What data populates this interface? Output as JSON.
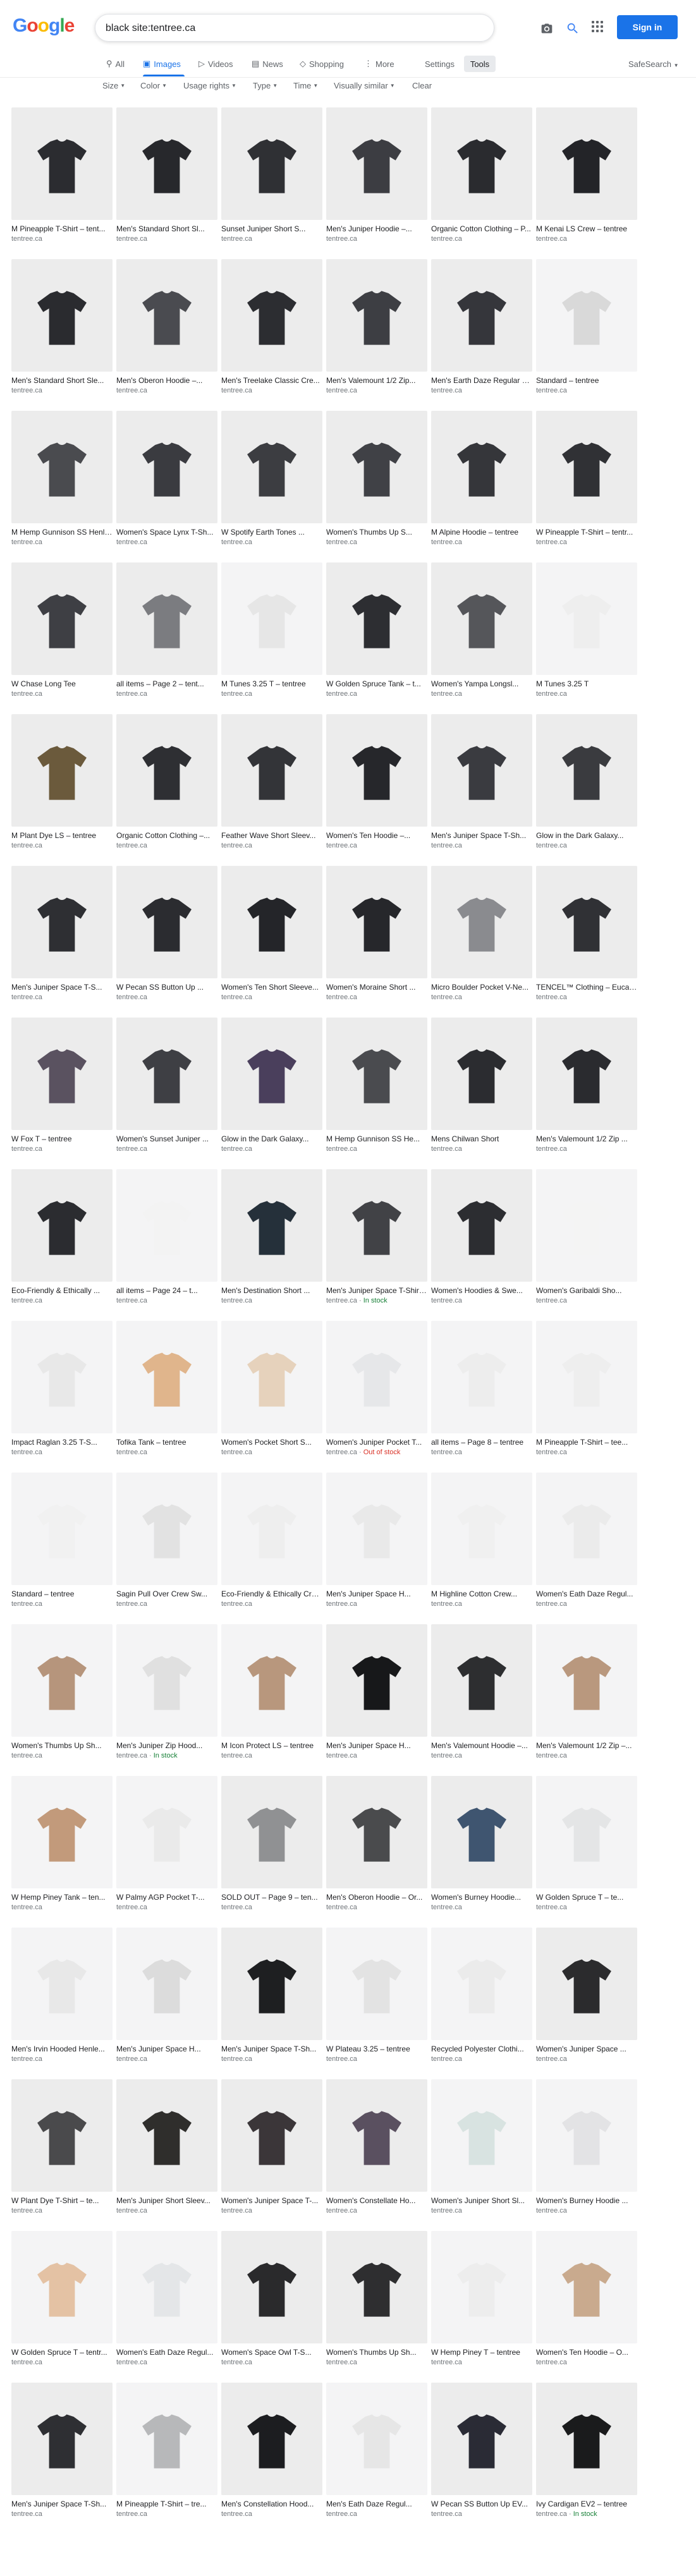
{
  "header": {
    "logo": "Google",
    "query": "black site:tentree.ca",
    "signin_label": "Sign in",
    "logo_colors": [
      "#4285f4",
      "#ea4335",
      "#fbbc05",
      "#4285f4",
      "#34a853",
      "#ea4335"
    ]
  },
  "tabs": [
    {
      "label": "All",
      "icon": "search-icon"
    },
    {
      "label": "Images",
      "icon": "image-icon"
    },
    {
      "label": "Videos",
      "icon": "video-icon"
    },
    {
      "label": "News",
      "icon": "news-icon"
    },
    {
      "label": "Shopping",
      "icon": "tag-icon"
    },
    {
      "label": "More",
      "icon": "more-icon"
    }
  ],
  "toolbar": {
    "settings": "Settings",
    "tools": "Tools",
    "safesearch": "SafeSearch"
  },
  "filters": [
    "Size",
    "Color",
    "Usage rights",
    "Type",
    "Time",
    "Visually similar",
    "Clear"
  ],
  "source_default": "tentree.ca",
  "rows": [
    [
      {
        "title": "M Pineapple T-Shirt – tent...",
        "color": "#2b2c30"
      },
      {
        "title": "Men's Standard Short Sl...",
        "color": "#27282c"
      },
      {
        "title": "Sunset Juniper Short S...",
        "color": "#2f3034"
      },
      {
        "title": "Men's Juniper Hoodie –...",
        "color": "#3c3d42"
      },
      {
        "title": "Organic Cotton Clothing – P...",
        "color": "#2a2b2f"
      },
      {
        "title": "M Kenai LS Crew – tentree",
        "color": "#232428"
      }
    ],
    [
      {
        "title": "Men's Standard Short Sle...",
        "color": "#2a2b2f"
      },
      {
        "title": "Men's Oberon Hoodie –...",
        "color": "#4a4b50"
      },
      {
        "title": "Men's Treelake Classic Cre...",
        "color": "#2c2d31"
      },
      {
        "title": "Men's Valemount 1/2 Zip...",
        "color": "#3d3e43"
      },
      {
        "title": "Men's Earth Daze Regular Fi...",
        "color": "#35363b"
      },
      {
        "title": "Standard – tentree",
        "color": "#d9d9d9"
      }
    ],
    [
      {
        "title": "M Hemp Gunnison SS Henley...",
        "color": "#4a4b4f"
      },
      {
        "title": "Women's Space Lynx T-Sh...",
        "color": "#3a3b40"
      },
      {
        "title": "W Spotify Earth Tones ...",
        "color": "#3c3d41"
      },
      {
        "title": "Women's Thumbs Up S...",
        "color": "#404146"
      },
      {
        "title": "M Alpine Hoodie – tentree",
        "color": "#35363a"
      },
      {
        "title": "W Pineapple T-Shirt – tentr...",
        "color": "#303135"
      }
    ],
    [
      {
        "title": "W Chase Long Tee",
        "color": "#3e3f44"
      },
      {
        "title": "all items – Page 2 – tent...",
        "color": "#7b7c80"
      },
      {
        "title": "M Tunes 3.25 T – tentree",
        "color": "#e6e6e6"
      },
      {
        "title": "W Golden Spruce Tank – t...",
        "color": "#2d2e32"
      },
      {
        "title": "Women's Yampa Longsl...",
        "color": "#55565a"
      },
      {
        "title": "M Tunes 3.25 T",
        "color": "#eeeeee"
      }
    ],
    [
      {
        "title": "M Plant Dye LS – tentree",
        "color": "#6b5a3c"
      },
      {
        "title": "Organic Cotton Clothing –...",
        "color": "#2e2f33"
      },
      {
        "title": "Feather Wave Short Sleev...",
        "color": "#333438"
      },
      {
        "title": "Women's Ten Hoodie –...",
        "color": "#26272b"
      },
      {
        "title": "Men's Juniper Space T-Sh...",
        "color": "#3a3b40"
      },
      {
        "title": "Glow in the Dark Galaxy...",
        "color": "#3a3b3f"
      }
    ],
    [
      {
        "title": "Men's Juniper Space T-S...",
        "color": "#2e2f33"
      },
      {
        "title": "W Pecan SS Button Up ...",
        "color": "#2b2c30"
      },
      {
        "title": "Women's Ten Short Sleeve...",
        "color": "#242529"
      },
      {
        "title": "Women's Moraine Short ...",
        "color": "#26272b"
      },
      {
        "title": "Micro Boulder Pocket V-Ne...",
        "color": "#8a8b8f"
      },
      {
        "title": "TENCEL™ Clothing – Eucal...",
        "color": "#303135"
      }
    ],
    [
      {
        "title": "W Fox T – tentree",
        "color": "#5a5260"
      },
      {
        "title": "Women's Sunset Juniper ...",
        "color": "#3e3f44"
      },
      {
        "title": "Glow in the Dark Galaxy...",
        "color": "#4a3f5c"
      },
      {
        "title": "M Hemp Gunnison SS He...",
        "color": "#4a4b4f"
      },
      {
        "title": "Mens Chilwan Short",
        "color": "#2b2c30"
      },
      {
        "title": "Men's Valemount 1/2 Zip ...",
        "color": "#2a2b2f"
      }
    ],
    [
      {
        "title": "Eco-Friendly & Ethically ...",
        "color": "#2b2c30"
      },
      {
        "title": "all items – Page 24 – t...",
        "color": "#f3f3f3"
      },
      {
        "title": "Men's Destination Short ...",
        "color": "#25303a"
      },
      {
        "title": "Men's Juniper Space T-Shirt – Tr...",
        "color": "#414246",
        "badge": "In stock"
      },
      {
        "title": "Women's Hoodies & Swe...",
        "color": "#2c2d31"
      },
      {
        "title": "Women's Garibaldi Sho...",
        "color": "#f4f4f4"
      }
    ],
    [
      {
        "title": "Impact Raglan 3.25 T-S...",
        "color": "#e8e8e8"
      },
      {
        "title": "Tofika Tank – tentree",
        "color": "#e0b58c"
      },
      {
        "title": "Women's Pocket Short S...",
        "color": "#e6d2bc"
      },
      {
        "title": "Women's Juniper Pocket T...",
        "color": "#e6e7e9",
        "badge": "Out of stock"
      },
      {
        "title": "all items – Page 8 – tentree",
        "color": "#ededed"
      },
      {
        "title": "M Pineapple T-Shirt – tee...",
        "color": "#eeeeee"
      }
    ],
    [
      {
        "title": "Standard – tentree",
        "color": "#f1f1f1"
      },
      {
        "title": "Sagin Pull Over Crew Sw...",
        "color": "#e2e2e2"
      },
      {
        "title": "Eco-Friendly & Ethically Craf...",
        "color": "#eeeeee"
      },
      {
        "title": "Men's Juniper Space H...",
        "color": "#e9e9e9"
      },
      {
        "title": "M Highline Cotton Crew...",
        "color": "#f0f0f0"
      },
      {
        "title": "Women's Eath Daze Regul...",
        "color": "#ebebeb"
      }
    ],
    [
      {
        "title": "Women's Thumbs Up Sh...",
        "color": "#b6957c"
      },
      {
        "title": "Men's Juniper Zip Hood...",
        "color": "#e0e0e0",
        "badge": "In stock"
      },
      {
        "title": "M Icon Protect LS – tentree",
        "color": "#b8977d"
      },
      {
        "title": "Men's Juniper Space H...",
        "color": "#17181a"
      },
      {
        "title": "Men's Valemount Hoodie –...",
        "color": "#2d2e30"
      },
      {
        "title": "Men's Valemount 1/2 Zip –...",
        "color": "#b9987e"
      }
    ],
    [
      {
        "title": "W Hemp Piney Tank – ten...",
        "color": "#c29a7b"
      },
      {
        "title": "W Palmy AGP Pocket T-...",
        "color": "#eaeaea"
      },
      {
        "title": "SOLD OUT – Page 9 – ten...",
        "color": "#909193"
      },
      {
        "title": "Men's Oberon Hoodie – Or...",
        "color": "#4a4b4d"
      },
      {
        "title": "Women's Burney Hoodie...",
        "color": "#3f5570"
      },
      {
        "title": "W Golden Spruce T – te...",
        "color": "#e4e5e6"
      }
    ],
    [
      {
        "title": "Men's Irvin Hooded Henle...",
        "color": "#e8e8e8"
      },
      {
        "title": "Men's Juniper Space H...",
        "color": "#dcdcdc"
      },
      {
        "title": "Men's Juniper Space T-Sh...",
        "color": "#1e1f21"
      },
      {
        "title": "W Plateau 3.25 – tentree",
        "color": "#e3e3e3"
      },
      {
        "title": "Recycled Polyester Clothi...",
        "color": "#ebebeb"
      },
      {
        "title": "Women's Juniper Space ...",
        "color": "#2b2b2d"
      }
    ],
    [
      {
        "title": "W Plant Dye T-Shirt – te...",
        "color": "#4a4a4c"
      },
      {
        "title": "Men's Juniper Short Sleev...",
        "color": "#2f2e2c"
      },
      {
        "title": "Women's Juniper Space T-...",
        "color": "#3b3639"
      },
      {
        "title": "Women's Constellate Ho...",
        "color": "#5a5060"
      },
      {
        "title": "Women's Juniper Short Sl...",
        "color": "#d8e3e1"
      },
      {
        "title": "Women's Burney Hoodie ...",
        "color": "#e3e3e5"
      }
    ],
    [
      {
        "title": "W Golden Spruce T – tentr...",
        "color": "#e4c2a4"
      },
      {
        "title": "Women's Eath Daze Regul...",
        "color": "#e4e6e8"
      },
      {
        "title": "Women's Space Owl T-S...",
        "color": "#2a2a2c"
      },
      {
        "title": "Women's Thumbs Up Sh...",
        "color": "#2e2e30"
      },
      {
        "title": "W Hemp Piney T – tentree",
        "color": "#ededed"
      },
      {
        "title": "Women's Ten Hoodie – O...",
        "color": "#c9aa8e"
      }
    ],
    [
      {
        "title": "Men's Juniper Space T-Sh...",
        "color": "#2e2f33"
      },
      {
        "title": "M Pineapple T-Shirt – tre...",
        "color": "#b7b8ba"
      },
      {
        "title": "Men's Constellation Hood...",
        "color": "#1c1d20"
      },
      {
        "title": "Men's Eath Daze Regul...",
        "color": "#e6e6e6"
      },
      {
        "title": "W Pecan SS Button Up EV...",
        "color": "#2a2b35"
      },
      {
        "title": "Ivy Cardigan EV2 – tentree",
        "color": "#1a1b1c",
        "badge": "In stock"
      }
    ]
  ]
}
